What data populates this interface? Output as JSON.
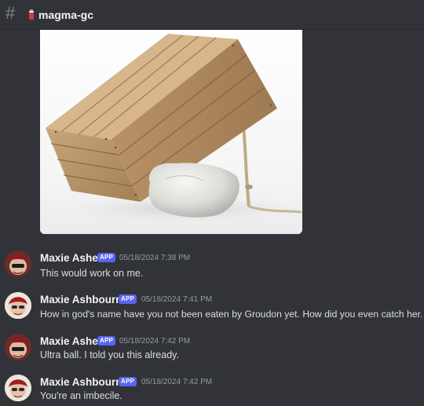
{
  "header": {
    "hash_icon": "hash-icon",
    "channel_emoji": "fire-extinguisher-icon",
    "channel_name": "magma-gc"
  },
  "attachment": {
    "icon": "image-attachment"
  },
  "messages": [
    {
      "author": "Maxie Asher",
      "badge": "APP",
      "timestamp": "05/18/2024 7:38 PM",
      "text": "This would work on me."
    },
    {
      "author": "Maxie Ashbourne",
      "badge": "APP",
      "timestamp": "05/18/2024 7:41 PM",
      "text": "How in god's name have you not been eaten by Groudon yet. How did you even catch her."
    },
    {
      "author": "Maxie Asher",
      "badge": "APP",
      "timestamp": "05/18/2024 7:42 PM",
      "text": "Ultra ball. I told you this already."
    },
    {
      "author": "Maxie Ashbourne",
      "badge": "APP",
      "timestamp": "05/18/2024 7:42 PM",
      "text": "You're an imbecile."
    }
  ],
  "colors": {
    "background": "#313338",
    "badge": "#5865f2",
    "timestamp": "#949ba4",
    "username": "#f2f3f5",
    "text": "#dbdee1"
  }
}
